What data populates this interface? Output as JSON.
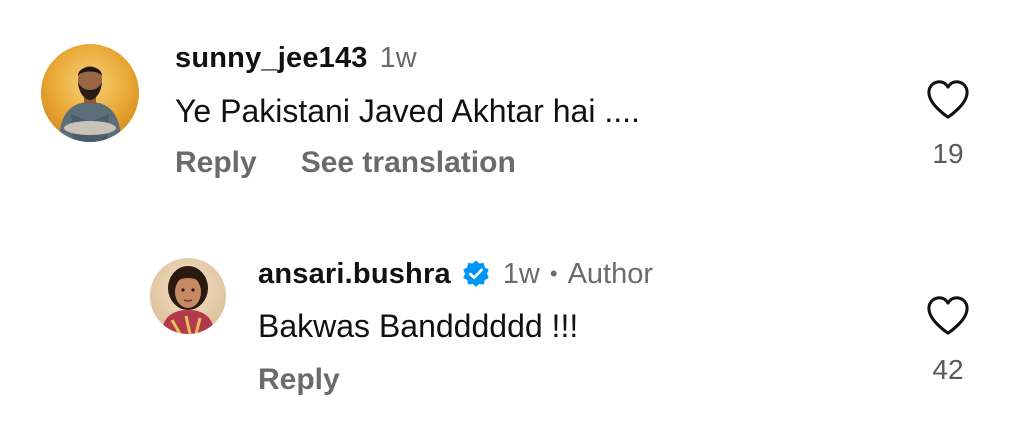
{
  "comments": [
    {
      "username": "sunny_jee143",
      "time": "1w",
      "text": "Ye Pakistani Javed Akhtar hai ....",
      "actions": [
        "Reply",
        "See translation"
      ],
      "likes": "19",
      "verified": false,
      "avatar": "user-photo"
    },
    {
      "username": "ansari.bushra",
      "time": "1w",
      "separator": "•",
      "badge": "Author",
      "text": "Bakwas Bandddddd !!!",
      "actions": [
        "Reply"
      ],
      "likes": "42",
      "verified": true,
      "avatar": "user-photo"
    }
  ],
  "colors": {
    "text": "#111111",
    "muted": "#6b6b6b",
    "verified": "#0095f6"
  },
  "icons": {
    "like": "heart-icon",
    "verified": "verified-badge-icon"
  }
}
